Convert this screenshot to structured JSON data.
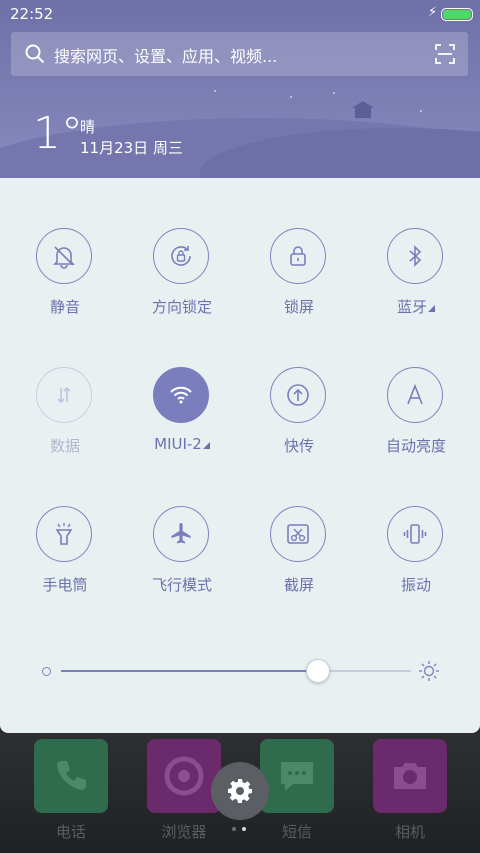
{
  "status_bar": {
    "time": "22:52"
  },
  "search": {
    "placeholder": "搜索网页、设置、应用、视频..."
  },
  "weather": {
    "temperature": "1°",
    "condition": "晴",
    "date": "11月23日 周三"
  },
  "toggles": [
    {
      "label": "静音",
      "icon": "bell-off-icon",
      "state": "off"
    },
    {
      "label": "方向锁定",
      "icon": "rotation-lock-icon",
      "state": "off"
    },
    {
      "label": "锁屏",
      "icon": "padlock-icon",
      "state": "off"
    },
    {
      "label": "蓝牙",
      "icon": "bluetooth-icon",
      "state": "off"
    },
    {
      "label": "数据",
      "icon": "mobile-data-icon",
      "state": "disabled"
    },
    {
      "label": "MIUI-2",
      "icon": "wifi-icon",
      "state": "on"
    },
    {
      "label": "快传",
      "icon": "share-upload-icon",
      "state": "off"
    },
    {
      "label": "自动亮度",
      "icon": "auto-brightness-icon",
      "state": "off"
    },
    {
      "label": "手电筒",
      "icon": "flashlight-icon",
      "state": "off"
    },
    {
      "label": "飞行模式",
      "icon": "airplane-icon",
      "state": "off"
    },
    {
      "label": "截屏",
      "icon": "screenshot-icon",
      "state": "off"
    },
    {
      "label": "振动",
      "icon": "vibrate-icon",
      "state": "off"
    }
  ],
  "brightness": {
    "level": 0.73
  },
  "dock": {
    "apps": [
      {
        "label": "电话",
        "icon": "phone-icon",
        "color": "#2f6b4d"
      },
      {
        "label": "浏览器",
        "icon": "browser-icon",
        "color": "#6a2a6c"
      },
      {
        "label": "短信",
        "icon": "message-icon",
        "color": "#2f6b4d"
      },
      {
        "label": "相机",
        "icon": "camera-icon",
        "color": "#6a2a6c"
      }
    ]
  },
  "colors": {
    "accent": "#7b7ebd",
    "panel_bg": "#e9f0f2",
    "header_bg": "#7677af"
  }
}
